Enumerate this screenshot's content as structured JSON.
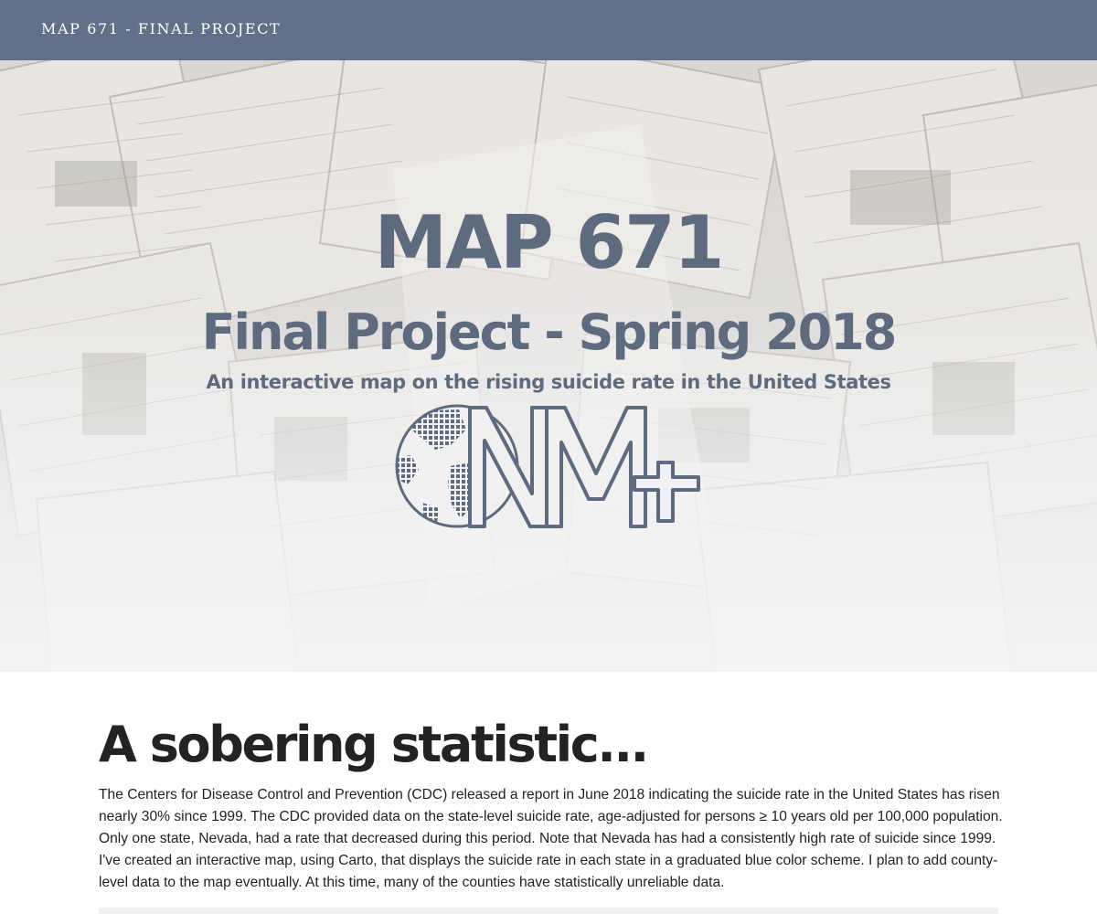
{
  "navbar": {
    "brand": "MAP 671 - FINAL PROJECT"
  },
  "hero": {
    "title": "MAP 671",
    "subtitle": "Final Project - Spring 2018",
    "tagline": "An interactive map on the rising suicide rate in the United States",
    "logo_icon": "nm-plus-globe-logo-icon"
  },
  "section": {
    "heading": "A sobering statistic...",
    "body": "The Centers for Disease Control and Prevention (CDC) released a report in June 2018 indicating the suicide rate in the United States has risen nearly 30% since 1999. The CDC provided data on the state-level suicide rate, age-adjusted for persons ≥ 10 years old per 100,000 population. Only one state, Nevada, had a rate that decreased during this period. Note that Nevada has had a consistently high rate of suicide since 1999. I've created an interactive map, using Carto, that displays the suicide rate in each state in a graduated blue color scheme. I plan to add county-level data to the map eventually. At this time, many of the counties have statistically unreliable data."
  },
  "colors": {
    "navbar": "#5f7088",
    "hero_text": "#5e6a7e",
    "heading_text": "#232323",
    "body_text": "#222222"
  }
}
